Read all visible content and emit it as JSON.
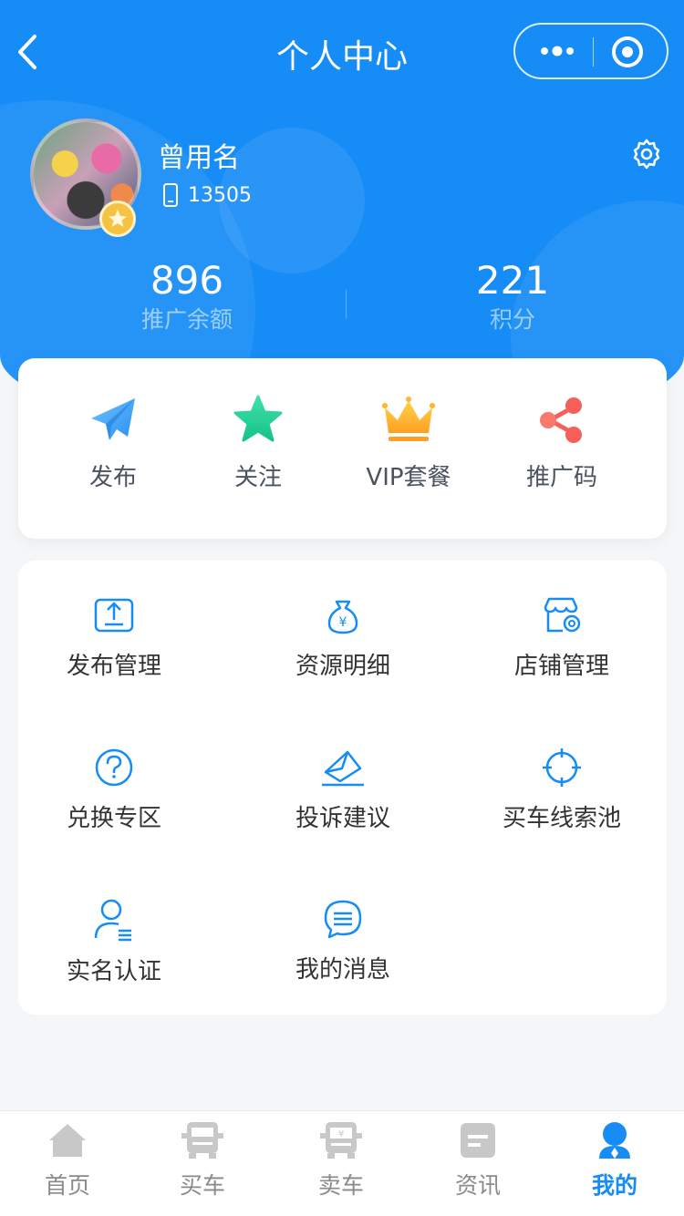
{
  "nav": {
    "title": "个人中心"
  },
  "profile": {
    "name": "曾用名",
    "phone": "13505"
  },
  "stats": [
    {
      "value": "896",
      "label": "推广余额"
    },
    {
      "value": "221",
      "label": "积分"
    }
  ],
  "quick": [
    {
      "label": "发布",
      "icon": "paper-plane-icon"
    },
    {
      "label": "关注",
      "icon": "star-icon"
    },
    {
      "label": "VIP套餐",
      "icon": "crown-icon"
    },
    {
      "label": "推广码",
      "icon": "share-icon"
    }
  ],
  "menu": [
    {
      "label": "发布管理",
      "icon": "upload-box-icon"
    },
    {
      "label": "资源明细",
      "icon": "money-bag-icon"
    },
    {
      "label": "店铺管理",
      "icon": "shop-settings-icon"
    },
    {
      "label": "兑换专区",
      "icon": "question-circle-icon"
    },
    {
      "label": "投诉建议",
      "icon": "envelope-icon"
    },
    {
      "label": "买车线索池",
      "icon": "target-icon"
    },
    {
      "label": "实名认证",
      "icon": "user-id-icon"
    },
    {
      "label": "我的消息",
      "icon": "message-bubble-icon"
    }
  ],
  "tabs": [
    {
      "label": "首页",
      "icon": "home-icon",
      "active": false
    },
    {
      "label": "买车",
      "icon": "truck-icon",
      "active": false
    },
    {
      "label": "卖车",
      "icon": "truck-sell-icon",
      "active": false
    },
    {
      "label": "资讯",
      "icon": "news-icon",
      "active": false
    },
    {
      "label": "我的",
      "icon": "user-icon",
      "active": true
    }
  ],
  "colors": {
    "primary": "#168cf7",
    "tab_inactive": "#8a8a8a",
    "background": "#f5f6f8"
  }
}
